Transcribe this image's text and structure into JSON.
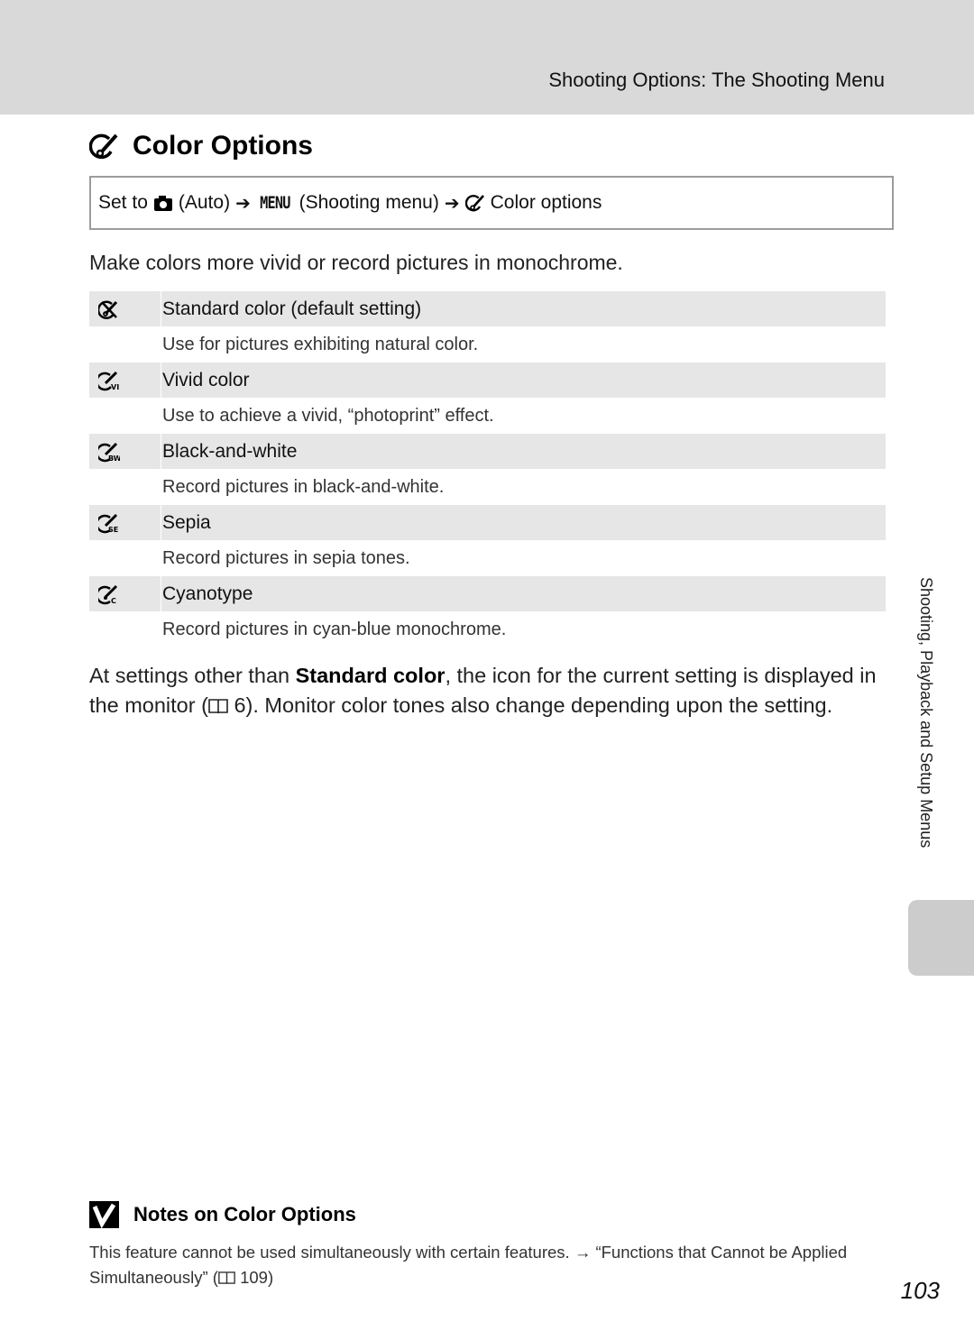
{
  "header": {
    "running_head": "Shooting Options: The Shooting Menu"
  },
  "title": {
    "icon": "color-options-icon",
    "text": "Color Options"
  },
  "set_to": {
    "prefix": "Set to",
    "mode_icon": "camera-auto-icon",
    "mode_label": "(Auto)",
    "arrow": "➔",
    "menu_glyph": "MENU",
    "menu_label": "(Shooting menu)",
    "option_icon": "color-options-icon",
    "option_label": "Color options"
  },
  "intro": "Make colors more vivid or record pictures in monochrome.",
  "options": [
    {
      "icon": "standard-color-icon",
      "label": "Standard color (default setting)",
      "description": "Use for pictures exhibiting natural color."
    },
    {
      "icon": "vivid-color-icon",
      "label": "Vivid color",
      "description": "Use to achieve a vivid, “photoprint” effect."
    },
    {
      "icon": "black-and-white-icon",
      "label": "Black-and-white",
      "description": "Record pictures in black-and-white."
    },
    {
      "icon": "sepia-icon",
      "label": "Sepia",
      "description": "Record pictures in sepia tones."
    },
    {
      "icon": "cyanotype-icon",
      "label": "Cyanotype",
      "description": "Record pictures in cyan-blue monochrome."
    }
  ],
  "body": {
    "part1": "At settings other than ",
    "bold": "Standard color",
    "part2": ", the icon for the current setting is displayed in the monitor (",
    "ref_page": "6",
    "part3": "). Monitor color tones also change depending upon the setting."
  },
  "side_tab_label": "Shooting, Playback and Setup Menus",
  "notes": {
    "heading": "Notes on Color Options",
    "text1": "This feature cannot be used simultaneously with certain features. → “Functions that Cannot be Applied Simultaneously” (",
    "ref_page": "109",
    "text2": ")"
  },
  "page_number": "103",
  "colors": {
    "header_band": "#d9d9d9",
    "row_bg": "#e6e6e6",
    "box_border": "#9c9c9c",
    "side_tab": "#cccccc"
  }
}
